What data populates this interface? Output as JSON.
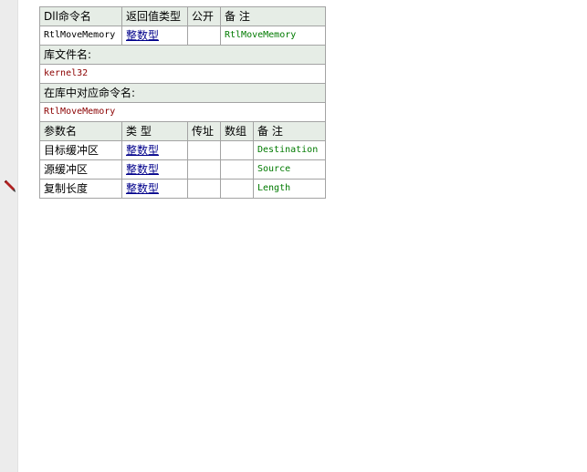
{
  "colors": {
    "header_bg": "#e6ede6",
    "border": "#a3a3a3",
    "link": "#00008b",
    "comment": "#007a00",
    "lib_value": "#8b0000",
    "gutter": "#ececec"
  },
  "icons": {
    "gutter_marker": "pen-icon"
  },
  "dll": {
    "headers": {
      "name": "Dll命令名",
      "return_type": "返回值类型",
      "public": "公开",
      "remark": "备 注"
    },
    "values": {
      "name": "RtlMoveMemory",
      "return_type": "整数型",
      "public": "",
      "remark": "RtlMoveMemory"
    },
    "library_label": "库文件名:",
    "library_value": "kernel32",
    "alias_label": "在库中对应命令名:",
    "alias_value": "RtlMoveMemory"
  },
  "params": {
    "headers": {
      "name": "参数名",
      "type": "类 型",
      "by_ref": "传址",
      "array": "数组",
      "remark": "备 注"
    },
    "rows": [
      {
        "name": "目标缓冲区",
        "type": "整数型",
        "by_ref": "",
        "array": "",
        "remark": "Destination"
      },
      {
        "name": "源缓冲区",
        "type": "整数型",
        "by_ref": "",
        "array": "",
        "remark": "Source"
      },
      {
        "name": "复制长度",
        "type": "整数型",
        "by_ref": "",
        "array": "",
        "remark": "Length"
      }
    ]
  }
}
